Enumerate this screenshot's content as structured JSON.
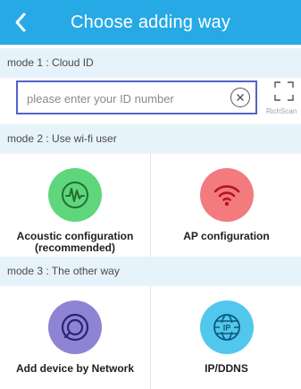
{
  "header": {
    "title": "Choose adding way",
    "back_icon": "chevron-left-icon",
    "bg_color": "#27a9e6"
  },
  "mode1": {
    "label": "mode 1 : Cloud ID",
    "input_placeholder": "please enter your ID number",
    "input_value": "",
    "clear_icon": "close-circle-icon",
    "scan_label": "RichScan",
    "scan_icon": "scan-frame-icon"
  },
  "mode2": {
    "label": "mode 2 : Use wi-fi user",
    "options": [
      {
        "label": "Acoustic configuration\n(recommended)",
        "icon": "soundwave-icon",
        "color": "#5fd67b"
      },
      {
        "label": "AP configuration",
        "icon": "wifi-icon",
        "color": "#f37b7e"
      }
    ]
  },
  "mode3": {
    "label": "mode 3 : The other way",
    "options": [
      {
        "label": "Add device by Network",
        "icon": "network-icon",
        "color": "#8e84d3"
      },
      {
        "label": "IP/DDNS",
        "icon": "globe-ip-icon",
        "color": "#52c7ed"
      }
    ]
  },
  "colors": {
    "section_bg": "#e7f3fb",
    "input_border": "#5063c9"
  }
}
